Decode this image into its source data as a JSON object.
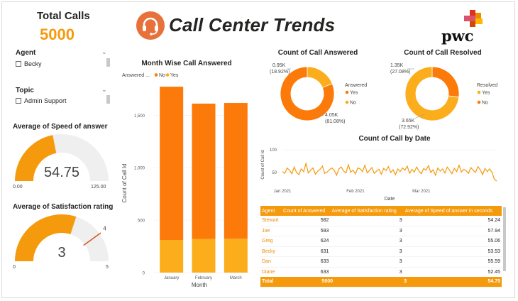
{
  "header": {
    "title": "Call Center Trends",
    "brand": "pwc"
  },
  "total_calls": {
    "label": "Total Calls",
    "value": "5000"
  },
  "slicers": {
    "agent": {
      "title": "Agent",
      "item": "Becky"
    },
    "topic": {
      "title": "Topic",
      "item": "Admin Support"
    }
  },
  "gauges": {
    "speed": {
      "title": "Average of Speed of answer",
      "value": "54.75",
      "min": "0.00",
      "max": "125.00",
      "fill_fraction": 0.438
    },
    "satisfaction": {
      "title": "Average of Satisfaction rating",
      "value": "3",
      "min": "0",
      "max": "5",
      "target": "4",
      "fill_fraction": 0.6,
      "target_fraction": 0.8
    }
  },
  "colors": {
    "accent_orange": "#f59a0c",
    "dark_orange": "#fb7a0a",
    "light_orange": "#fbad1c",
    "track": "#efefef",
    "logo": "#e8703a"
  },
  "icons": {
    "logo": "headset-icon"
  },
  "chart_data": [
    {
      "type": "bar",
      "title": "Month Wise Call Answered",
      "legend_title": "Answered ...",
      "legend": [
        "No",
        "Yes"
      ],
      "xlabel": "Month",
      "ylabel": "Count of Call Id",
      "categories": [
        "January",
        "February",
        "March"
      ],
      "yticks": [
        "0",
        "500",
        "1,000",
        "1,500"
      ],
      "ylim": [
        0,
        1800
      ],
      "series": [
        {
          "name": "No",
          "values": [
            1461,
            1290,
            1294
          ],
          "color": "#fb7a0a"
        },
        {
          "name": "Yes",
          "values": [
            311,
            321,
            323
          ],
          "color": "#fbad1c"
        }
      ]
    },
    {
      "type": "pie",
      "title": "Count of Call Answered",
      "legend_title": "Answered",
      "slices": [
        {
          "name": "Yes",
          "value": 4054,
          "label": "4.05K",
          "pct": "(81.08%)",
          "color": "#fb7a0a"
        },
        {
          "name": "No",
          "value": 946,
          "label": "0.95K",
          "pct": "(18.92%)",
          "color": "#fbad1c"
        }
      ]
    },
    {
      "type": "pie",
      "title": "Count of Call Resolved",
      "legend_title": "Resolved",
      "slices": [
        {
          "name": "Yes",
          "value": 3646,
          "label": "3.65K",
          "pct": "(72.92%)",
          "color": "#fbad1c"
        },
        {
          "name": "No",
          "value": 1354,
          "label": "1.35K",
          "pct": "(27.08%)",
          "color": "#fb7a0a"
        }
      ]
    },
    {
      "type": "line",
      "title": "Count of Call by Date",
      "xlabel": "Date",
      "ylabel": "Count of Call Id",
      "xticks": [
        "Jan 2021",
        "Feb 2021",
        "Mar 2021"
      ],
      "yticks": [
        "50",
        "100"
      ],
      "ylim": [
        20,
        105
      ],
      "values": [
        52,
        48,
        60,
        55,
        47,
        62,
        50,
        45,
        58,
        52,
        70,
        49,
        55,
        60,
        46,
        53,
        57,
        64,
        48,
        51,
        56,
        60,
        55,
        44,
        58,
        62,
        53,
        49,
        67,
        51,
        55,
        47,
        60,
        58,
        52,
        66,
        49,
        55,
        61,
        48,
        53,
        57,
        46,
        59,
        54,
        63,
        50,
        56,
        45,
        58,
        52,
        60,
        55,
        64,
        48,
        57,
        51,
        62,
        53,
        47,
        59,
        55,
        65,
        50,
        56,
        44,
        60,
        53,
        58,
        49,
        62,
        55,
        47,
        59,
        52,
        66,
        51,
        57,
        54,
        48,
        61,
        55,
        50,
        63,
        56,
        45,
        59,
        52,
        58,
        50,
        35,
        31
      ]
    },
    {
      "type": "table",
      "columns": [
        "Agent",
        "Count of Answered",
        "Average of Satisfaction rating",
        "Average of Speed of answer in seconds"
      ],
      "rows": [
        [
          "Stewart",
          "582",
          "3",
          "54.24"
        ],
        [
          "Joe",
          "593",
          "3",
          "57.94"
        ],
        [
          "Greg",
          "624",
          "3",
          "55.06"
        ],
        [
          "Becky",
          "631",
          "3",
          "53.53"
        ],
        [
          "Dan",
          "633",
          "3",
          "55.59"
        ],
        [
          "Diane",
          "633",
          "3",
          "52.45"
        ]
      ],
      "total": [
        "Total",
        "5000",
        "3",
        "54.75"
      ]
    }
  ]
}
